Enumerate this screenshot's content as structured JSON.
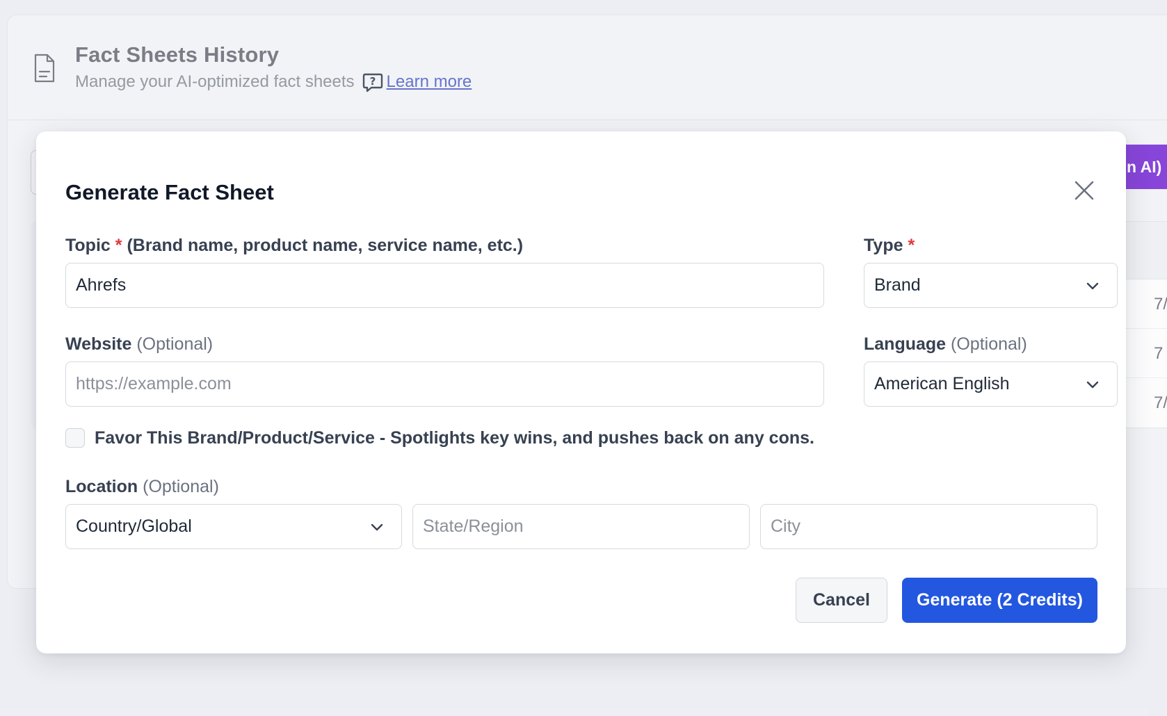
{
  "background": {
    "title": "Fact Sheets History",
    "subtitle": "Manage your AI-optimized fact sheets",
    "learn_more": "Learn more",
    "ai_button_partial": "n AI)",
    "table_rows": [
      "7/",
      "7",
      "7/"
    ]
  },
  "modal": {
    "title": "Generate Fact Sheet",
    "topic": {
      "label": "Topic",
      "required_mark": "*",
      "hint": "(Brand name, product name, service name, etc.)",
      "value": "Ahrefs"
    },
    "type": {
      "label": "Type",
      "required_mark": "*",
      "selected": "Brand"
    },
    "website": {
      "label": "Website",
      "optional": "(Optional)",
      "placeholder": "https://example.com",
      "value": ""
    },
    "language": {
      "label": "Language",
      "optional": "(Optional)",
      "selected": "American English"
    },
    "favor": {
      "label": "Favor This Brand/Product/Service - Spotlights key wins, and pushes back on any cons.",
      "checked": false
    },
    "location": {
      "label": "Location",
      "optional": "(Optional)",
      "country_selected": "Country/Global",
      "state_placeholder": "State/Region",
      "city_placeholder": "City"
    },
    "cancel_label": "Cancel",
    "generate_label": "Generate (2 Credits)"
  },
  "colors": {
    "primary": "#2357e0",
    "ai_purple": "#7a2fd6",
    "required": "#e0393e",
    "link": "#5565c8"
  },
  "icons": {
    "header": "document-icon",
    "help": "question-chat-icon",
    "close": "close-icon",
    "dropdown": "chevron-down-icon"
  }
}
